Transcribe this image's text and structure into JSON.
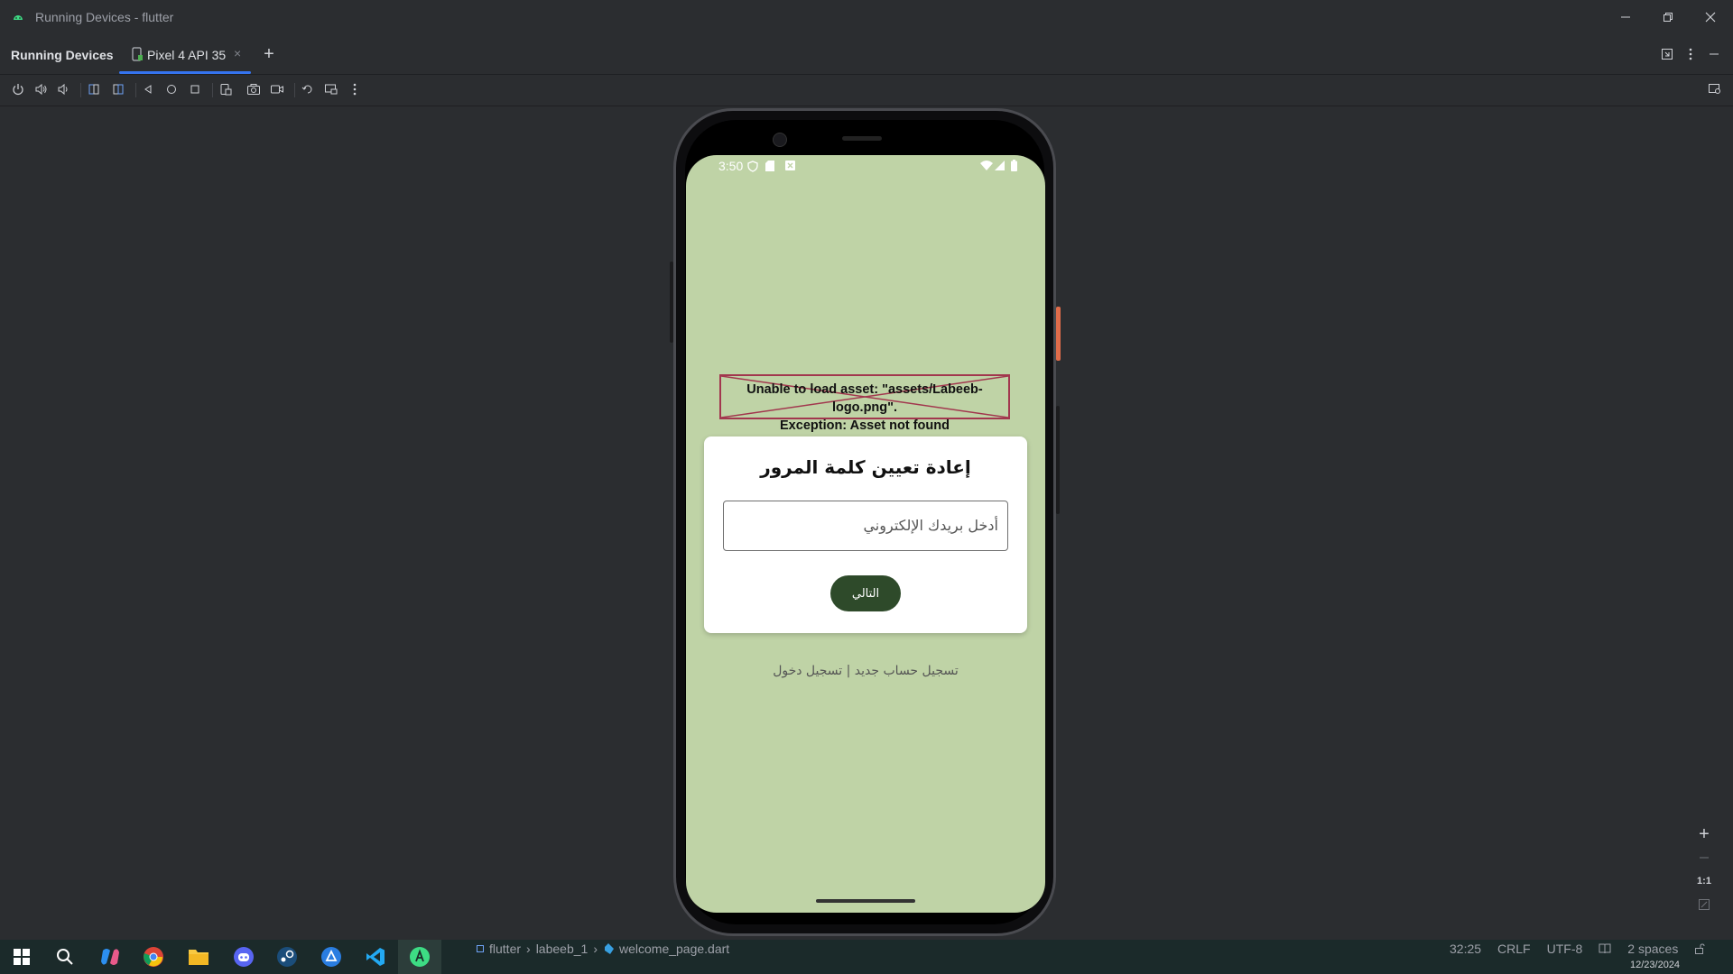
{
  "window": {
    "title": "Running Devices - flutter"
  },
  "tabbar": {
    "panel_title": "Running Devices",
    "tabs": [
      {
        "label": "Pixel 4 API 35"
      }
    ]
  },
  "device": {
    "status_time": "3:50",
    "asset_error": {
      "line1": "Unable to load asset: \"assets/Labeeb-logo.png\".",
      "line2": "Exception: Asset not found"
    },
    "card": {
      "title": "إعادة تعيين كلمة المرور",
      "email_placeholder": "أدخل بريدك الإلكتروني",
      "next_label": "التالي"
    },
    "footer_links": "تسجيل حساب جديد | تسجيل دخول"
  },
  "zoom": {
    "one_to_one": "1:1"
  },
  "breadcrumb": {
    "project": "flutter",
    "folder": "labeeb_1",
    "file": "welcome_page.dart"
  },
  "statusbar": {
    "position": "32:25",
    "line_sep": "CRLF",
    "encoding": "UTF-8",
    "indent": "2 spaces"
  },
  "clock": {
    "date": "12/23/2024"
  },
  "colors": {
    "accent": "#3574f0",
    "screen_bg": "#bfd3a6",
    "button_bg": "#2e4a2a",
    "error_border": "#a2374e"
  }
}
